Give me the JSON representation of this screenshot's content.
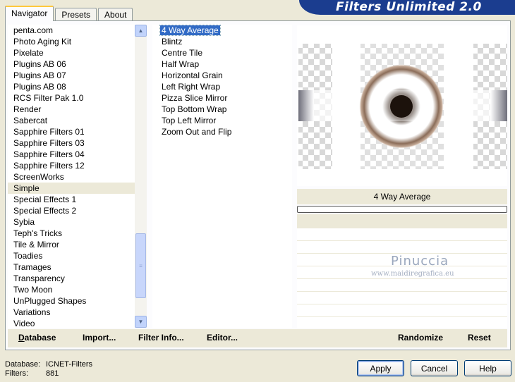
{
  "tabs": [
    {
      "label": "Navigator",
      "active": true
    },
    {
      "label": "Presets",
      "active": false
    },
    {
      "label": "About",
      "active": false
    }
  ],
  "banner": {
    "title": "Filters Unlimited 2.0"
  },
  "categories": {
    "items": [
      "penta.com",
      "Photo Aging Kit",
      "Pixelate",
      "Plugins AB 06",
      "Plugins AB 07",
      "Plugins AB 08",
      "RCS Filter Pak 1.0",
      "Render",
      "Sabercat",
      "Sapphire Filters 01",
      "Sapphire Filters 03",
      "Sapphire Filters 04",
      "Sapphire Filters 12",
      "ScreenWorks",
      "Simple",
      "Special Effects 1",
      "Special Effects 2",
      "Sybia",
      "Teph's Tricks",
      "Tile & Mirror",
      "Toadies",
      "Tramages",
      "Transparency",
      "Two Moon",
      "UnPlugged Shapes",
      "Variations",
      "Video"
    ],
    "selected": "Simple"
  },
  "filters": {
    "items": [
      "4 Way Average",
      "Blintz",
      "Centre Tile",
      "Half Wrap",
      "Horizontal Grain",
      "Left Right Wrap",
      "Pizza Slice Mirror",
      "Top Bottom Wrap",
      "Top Left Mirror",
      "Zoom Out and Flip"
    ],
    "selected": "4 Way Average"
  },
  "preview": {
    "caption": "4 Way Average",
    "progress": 0
  },
  "watermark": {
    "line1": "Pinuccia",
    "line2": "www.maidiregrafica.eu"
  },
  "actions": {
    "database": "Database",
    "import": "Import...",
    "filter_info": "Filter Info...",
    "editor": "Editor...",
    "randomize": "Randomize",
    "reset": "Reset"
  },
  "status": {
    "database_label": "Database:",
    "database_value": "ICNET-Filters",
    "filters_label": "Filters:",
    "filters_value": "881"
  },
  "buttons": {
    "apply": "Apply",
    "cancel": "Cancel",
    "help": "Help"
  },
  "colors": {
    "banner": "#1b3d8f",
    "selection": "#316ac5",
    "dialog_bg": "#ece9d8"
  },
  "icons": {
    "scroll_up": "up-arrow-icon",
    "scroll_down": "down-arrow-icon"
  }
}
